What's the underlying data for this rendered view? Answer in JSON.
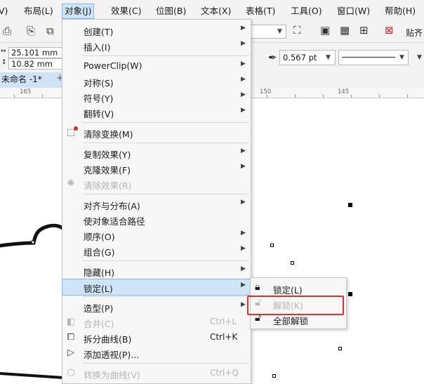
{
  "menubar": [
    {
      "label": "V)"
    },
    {
      "label": "布局(L)"
    },
    {
      "label": "对象(J)",
      "active": true
    },
    {
      "label": "效果(C)"
    },
    {
      "label": "位图(B)"
    },
    {
      "label": "文本(X)"
    },
    {
      "label": "表格(T)"
    },
    {
      "label": "工具(O)"
    },
    {
      "label": "窗口(W)"
    },
    {
      "label": "帮助(H)"
    }
  ],
  "toolbar": {
    "width_value": "25.101 mm",
    "height_value": "10.82 mm",
    "outline_width": "0.567 pt",
    "paste_label": "贴齐"
  },
  "document_tab": "未命名 -1*",
  "ruler": {
    "ticks": [
      "165",
      "150",
      "145"
    ]
  },
  "menu": {
    "items": [
      {
        "label": "创建(T)",
        "sub": true
      },
      {
        "label": "插入(I)",
        "sub": true
      },
      {
        "sep": true
      },
      {
        "label": "PowerClip(W)",
        "sub": true
      },
      {
        "label": "对称(S)",
        "sub": true
      },
      {
        "label": "符号(Y)",
        "sub": true
      },
      {
        "label": "翻转(V)",
        "sub": true
      },
      {
        "sep": true
      },
      {
        "label": "清除变换(M)",
        "icon": "clear-transform-icon"
      },
      {
        "sep": true
      },
      {
        "label": "复制效果(Y)",
        "sub": true
      },
      {
        "label": "克隆效果(F)",
        "sub": true
      },
      {
        "label": "清除效果(R)",
        "disabled": true,
        "icon": "clear-effect-icon"
      },
      {
        "sep": true
      },
      {
        "label": "对齐与分布(A)",
        "sub": true
      },
      {
        "label": "使对象适合路径"
      },
      {
        "label": "顺序(O)",
        "sub": true
      },
      {
        "label": "组合(G)",
        "sub": true
      },
      {
        "sep": true
      },
      {
        "label": "隐藏(H)",
        "sub": true
      },
      {
        "label": "锁定(L)",
        "sub": true,
        "highlighted": true
      },
      {
        "sep": true
      },
      {
        "label": "造型(P)",
        "sub": true
      },
      {
        "label": "合并(C)",
        "shortcut": "Ctrl+L",
        "disabled": true,
        "icon": "combine-icon"
      },
      {
        "label": "拆分曲线(B)",
        "shortcut": "Ctrl+K",
        "icon": "break-apart-icon"
      },
      {
        "label": "添加透视(P)...",
        "icon": "perspective-icon"
      },
      {
        "sep": true
      },
      {
        "label": "转换为曲线(V)",
        "shortcut": "Ctrl+Q",
        "disabled": true,
        "icon": "convert-curves-icon"
      }
    ]
  },
  "submenu": {
    "items": [
      {
        "label": "锁定(L)",
        "icon": "lock-icon"
      },
      {
        "label": "解锁(K)",
        "icon": "unlock-icon",
        "disabled": true
      },
      {
        "label": "全部解锁",
        "icon": "unlock-all-icon"
      }
    ]
  },
  "colors": {
    "highlight": "#cde5f7",
    "highlight_border": "#7fb6e3",
    "annotation": "#e0302b"
  }
}
